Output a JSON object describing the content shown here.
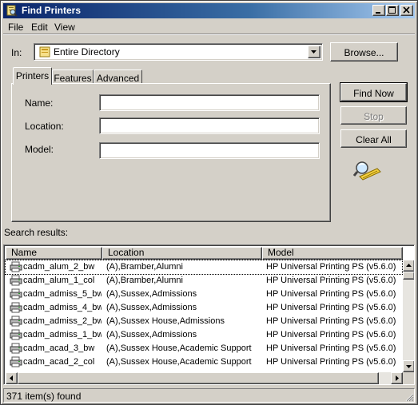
{
  "window": {
    "title": "Find Printers"
  },
  "menu": {
    "file": "File",
    "edit": "Edit",
    "view": "View"
  },
  "in_row": {
    "label": "In:",
    "selected": "Entire Directory",
    "browse_label": "Browse..."
  },
  "tabs": {
    "printers": "Printers",
    "features": "Features",
    "advanced": "Advanced"
  },
  "form": {
    "name_label": "Name:",
    "name_value": "",
    "location_label": "Location:",
    "location_value": "",
    "model_label": "Model:",
    "model_value": ""
  },
  "actions": {
    "find_now": "Find Now",
    "stop": "Stop",
    "clear_all": "Clear All"
  },
  "results": {
    "label": "Search results:",
    "columns": {
      "name": "Name",
      "location": "Location",
      "model": "Model"
    },
    "rows": [
      {
        "name": "cadm_alum_2_bw",
        "location": "(A),Bramber,Alumni",
        "model": "HP Universal Printing PS (v5.6.0)"
      },
      {
        "name": "cadm_alum_1_col",
        "location": "(A),Bramber,Alumni",
        "model": "HP Universal Printing PS (v5.6.0)"
      },
      {
        "name": "cadm_admiss_5_bw",
        "location": "(A),Sussex,Admissions",
        "model": "HP Universal Printing PS (v5.6.0)"
      },
      {
        "name": "cadm_admiss_4_bw",
        "location": "(A),Sussex,Admissions",
        "model": "HP Universal Printing PS (v5.6.0)"
      },
      {
        "name": "cadm_admiss_2_bw",
        "location": "(A),Sussex House,Admissions",
        "model": "HP Universal Printing PS (v5.6.0)"
      },
      {
        "name": "cadm_admiss_1_bw",
        "location": "(A),Sussex,Admissions",
        "model": "HP Universal Printing PS (v5.6.0)"
      },
      {
        "name": "cadm_acad_3_bw",
        "location": "(A),Sussex House,Academic Support",
        "model": "HP Universal Printing PS (v5.6.0)"
      },
      {
        "name": "cadm_acad_2_col",
        "location": "(A),Sussex House,Academic Support",
        "model": "HP Universal Printing PS (v5.6.0)"
      }
    ]
  },
  "status": {
    "count_text": "371 item(s) found"
  }
}
